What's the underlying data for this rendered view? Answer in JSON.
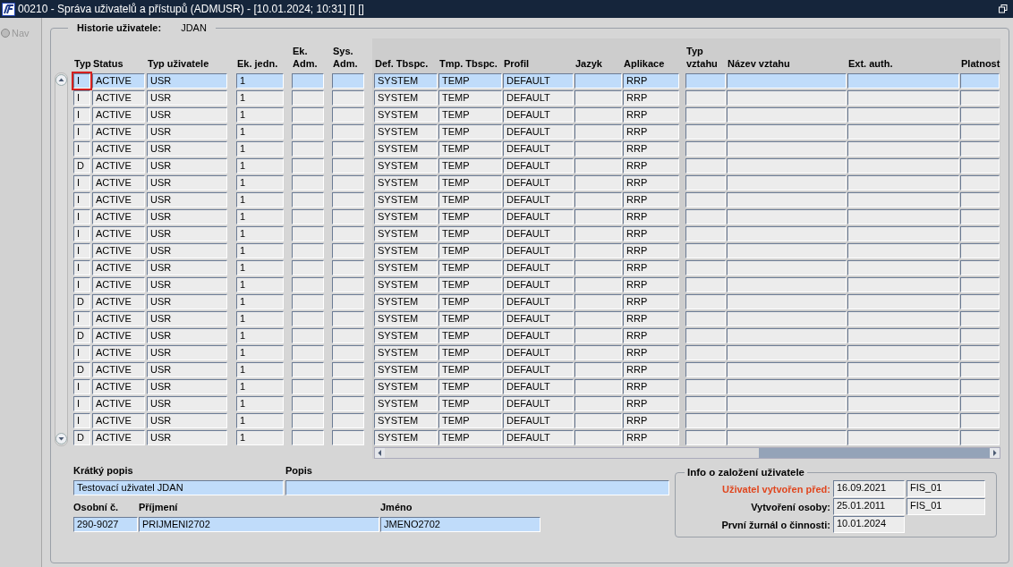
{
  "window": {
    "title": "00210 - Správa uživatelů a přístupů (ADMUSR) - [10.01.2024; 10:31] [] []"
  },
  "nav": {
    "label": "Nav",
    "selected": false
  },
  "history": {
    "label": "Historie uživatele:",
    "user": "JDAN"
  },
  "table": {
    "columns": [
      "Typ",
      "Status",
      "Typ uživatele",
      "Ek. jedn.",
      "Ek. Adm.",
      "Sys. Adm.",
      "Def. Tbspc.",
      "Tmp. Tbspc.",
      "Profil",
      "Jazyk",
      "Aplikace",
      "Typ vztahu",
      "Název vztahu",
      "Ext. auth.",
      "Platnost"
    ],
    "rows": [
      {
        "typ": "I",
        "status": "ACTIVE",
        "typ_uzivatele": "USR",
        "ek_jedn": "1",
        "def_tbspc": "SYSTEM",
        "tmp_tbspc": "TEMP",
        "profil": "DEFAULT",
        "aplikace": "RRP",
        "selected": true,
        "focused": true
      },
      {
        "typ": "I",
        "status": "ACTIVE",
        "typ_uzivatele": "USR",
        "ek_jedn": "1",
        "def_tbspc": "SYSTEM",
        "tmp_tbspc": "TEMP",
        "profil": "DEFAULT",
        "aplikace": "RRP",
        "selected": false,
        "focused": false
      },
      {
        "typ": "I",
        "status": "ACTIVE",
        "typ_uzivatele": "USR",
        "ek_jedn": "1",
        "def_tbspc": "SYSTEM",
        "tmp_tbspc": "TEMP",
        "profil": "DEFAULT",
        "aplikace": "RRP",
        "selected": false,
        "focused": false
      },
      {
        "typ": "I",
        "status": "ACTIVE",
        "typ_uzivatele": "USR",
        "ek_jedn": "1",
        "def_tbspc": "SYSTEM",
        "tmp_tbspc": "TEMP",
        "profil": "DEFAULT",
        "aplikace": "RRP",
        "selected": false,
        "focused": false
      },
      {
        "typ": "I",
        "status": "ACTIVE",
        "typ_uzivatele": "USR",
        "ek_jedn": "1",
        "def_tbspc": "SYSTEM",
        "tmp_tbspc": "TEMP",
        "profil": "DEFAULT",
        "aplikace": "RRP",
        "selected": false,
        "focused": false
      },
      {
        "typ": "D",
        "status": "ACTIVE",
        "typ_uzivatele": "USR",
        "ek_jedn": "1",
        "def_tbspc": "SYSTEM",
        "tmp_tbspc": "TEMP",
        "profil": "DEFAULT",
        "aplikace": "RRP",
        "selected": false,
        "focused": false
      },
      {
        "typ": "I",
        "status": "ACTIVE",
        "typ_uzivatele": "USR",
        "ek_jedn": "1",
        "def_tbspc": "SYSTEM",
        "tmp_tbspc": "TEMP",
        "profil": "DEFAULT",
        "aplikace": "RRP",
        "selected": false,
        "focused": false
      },
      {
        "typ": "I",
        "status": "ACTIVE",
        "typ_uzivatele": "USR",
        "ek_jedn": "1",
        "def_tbspc": "SYSTEM",
        "tmp_tbspc": "TEMP",
        "profil": "DEFAULT",
        "aplikace": "RRP",
        "selected": false,
        "focused": false
      },
      {
        "typ": "I",
        "status": "ACTIVE",
        "typ_uzivatele": "USR",
        "ek_jedn": "1",
        "def_tbspc": "SYSTEM",
        "tmp_tbspc": "TEMP",
        "profil": "DEFAULT",
        "aplikace": "RRP",
        "selected": false,
        "focused": false
      },
      {
        "typ": "I",
        "status": "ACTIVE",
        "typ_uzivatele": "USR",
        "ek_jedn": "1",
        "def_tbspc": "SYSTEM",
        "tmp_tbspc": "TEMP",
        "profil": "DEFAULT",
        "aplikace": "RRP",
        "selected": false,
        "focused": false
      },
      {
        "typ": "I",
        "status": "ACTIVE",
        "typ_uzivatele": "USR",
        "ek_jedn": "1",
        "def_tbspc": "SYSTEM",
        "tmp_tbspc": "TEMP",
        "profil": "DEFAULT",
        "aplikace": "RRP",
        "selected": false,
        "focused": false
      },
      {
        "typ": "I",
        "status": "ACTIVE",
        "typ_uzivatele": "USR",
        "ek_jedn": "1",
        "def_tbspc": "SYSTEM",
        "tmp_tbspc": "TEMP",
        "profil": "DEFAULT",
        "aplikace": "RRP",
        "selected": false,
        "focused": false
      },
      {
        "typ": "I",
        "status": "ACTIVE",
        "typ_uzivatele": "USR",
        "ek_jedn": "1",
        "def_tbspc": "SYSTEM",
        "tmp_tbspc": "TEMP",
        "profil": "DEFAULT",
        "aplikace": "RRP",
        "selected": false,
        "focused": false
      },
      {
        "typ": "D",
        "status": "ACTIVE",
        "typ_uzivatele": "USR",
        "ek_jedn": "1",
        "def_tbspc": "SYSTEM",
        "tmp_tbspc": "TEMP",
        "profil": "DEFAULT",
        "aplikace": "RRP",
        "selected": false,
        "focused": false
      },
      {
        "typ": "I",
        "status": "ACTIVE",
        "typ_uzivatele": "USR",
        "ek_jedn": "1",
        "def_tbspc": "SYSTEM",
        "tmp_tbspc": "TEMP",
        "profil": "DEFAULT",
        "aplikace": "RRP",
        "selected": false,
        "focused": false
      },
      {
        "typ": "D",
        "status": "ACTIVE",
        "typ_uzivatele": "USR",
        "ek_jedn": "1",
        "def_tbspc": "SYSTEM",
        "tmp_tbspc": "TEMP",
        "profil": "DEFAULT",
        "aplikace": "RRP",
        "selected": false,
        "focused": false
      },
      {
        "typ": "I",
        "status": "ACTIVE",
        "typ_uzivatele": "USR",
        "ek_jedn": "1",
        "def_tbspc": "SYSTEM",
        "tmp_tbspc": "TEMP",
        "profil": "DEFAULT",
        "aplikace": "RRP",
        "selected": false,
        "focused": false
      },
      {
        "typ": "D",
        "status": "ACTIVE",
        "typ_uzivatele": "USR",
        "ek_jedn": "1",
        "def_tbspc": "SYSTEM",
        "tmp_tbspc": "TEMP",
        "profil": "DEFAULT",
        "aplikace": "RRP",
        "selected": false,
        "focused": false
      },
      {
        "typ": "I",
        "status": "ACTIVE",
        "typ_uzivatele": "USR",
        "ek_jedn": "1",
        "def_tbspc": "SYSTEM",
        "tmp_tbspc": "TEMP",
        "profil": "DEFAULT",
        "aplikace": "RRP",
        "selected": false,
        "focused": false
      },
      {
        "typ": "I",
        "status": "ACTIVE",
        "typ_uzivatele": "USR",
        "ek_jedn": "1",
        "def_tbspc": "SYSTEM",
        "tmp_tbspc": "TEMP",
        "profil": "DEFAULT",
        "aplikace": "RRP",
        "selected": false,
        "focused": false
      },
      {
        "typ": "I",
        "status": "ACTIVE",
        "typ_uzivatele": "USR",
        "ek_jedn": "1",
        "def_tbspc": "SYSTEM",
        "tmp_tbspc": "TEMP",
        "profil": "DEFAULT",
        "aplikace": "RRP",
        "selected": false,
        "focused": false
      },
      {
        "typ": "D",
        "status": "ACTIVE",
        "typ_uzivatele": "USR",
        "ek_jedn": "1",
        "def_tbspc": "SYSTEM",
        "tmp_tbspc": "TEMP",
        "profil": "DEFAULT",
        "aplikace": "RRP",
        "selected": false,
        "focused": false
      }
    ]
  },
  "details": {
    "short_description": {
      "label": "Krátký popis",
      "value": "Testovací uživatel JDAN"
    },
    "description": {
      "label": "Popis"
    },
    "personal_number": {
      "label": "Osobní č.",
      "value": "290-9027"
    },
    "surname": {
      "label": "Příjmení",
      "value": "PRIJMENI2702"
    },
    "first_name": {
      "label": "Jméno",
      "value": "JMENO2702"
    }
  },
  "creation_info": {
    "title": "Info o založení uživatele",
    "rows": [
      {
        "label": "Uživatel vytvořen před:",
        "date": "16.09.2021",
        "user": "FIS_01",
        "highlighted": true
      },
      {
        "label": "Vytvoření osoby:",
        "date": "25.01.2011",
        "user": "FIS_01",
        "highlighted": false
      },
      {
        "label": "První žurnál o činnosti:",
        "date": "10.01.2024",
        "highlighted": false
      }
    ]
  }
}
